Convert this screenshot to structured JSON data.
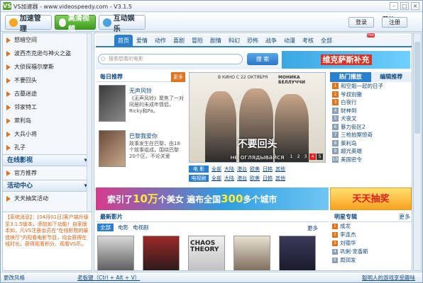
{
  "window": {
    "title": "VS加速器 - www.videospeedy.com - V3.1.5",
    "logo_text": "VS"
  },
  "toolbar": {
    "btn_accelerate": "加速管理",
    "btn_hd": "高清视频",
    "btn_social": "互动娱乐",
    "user": "菜单",
    "login": "登录",
    "register": "注册"
  },
  "sidebar": {
    "items": [
      "怒暗空间",
      "波西杰克逊与神火之盗",
      "大侦探福尔摩斯",
      "不要回头",
      "古墓迷途",
      "邻家特工",
      "萊利岛",
      "大兵小将",
      "孔子"
    ],
    "section_online": "在线影视",
    "online_items": [
      "官方推荐"
    ],
    "section_activity": "活动中心",
    "activity_items": [
      "天天抽奖活动"
    ],
    "system_msg": "【系统消息】：[04月01日]客户端升级至3.1.5版本，添加如下功能！自家版本如，凡VS注册会员在\"在线影院的最佳映厅\"内观看电影节目，均会获得在线时长，获得观看积分、观看VS币。"
  },
  "categories": [
    "首页",
    "爱情",
    "动作",
    "喜剧",
    "冒险",
    "剧情",
    "科幻",
    "恐怖",
    "战争",
    "动漫",
    "考核",
    "全部"
  ],
  "hot_badge": "Hot",
  "search": {
    "placeholder": "搜索想看的电影",
    "button": "搜 索"
  },
  "banner_top": {
    "text": "维克萨斯补充"
  },
  "daily": {
    "title": "每日推荐",
    "more": "更多",
    "cards": [
      {
        "title": "无声风铃",
        "desc": "《无声风铃》聚焦了一对同居的未成年情侣，Ricky和Pa。"
      },
      {
        "title": "巴黎我爱你",
        "desc": "故事发生在巴黎，由18个故事组成，围绕巴黎20个区，不论关爱"
      }
    ]
  },
  "slideshow": {
    "top_left": "В КИНО С 22 ОКТЯБРЯ",
    "top_right": "МОНИКА БЕЛЛУЧЧИ",
    "caption_cn": "不要回头",
    "caption_ru": "не оглядывайся",
    "pages": [
      "1",
      "2",
      "3",
      "4",
      "5"
    ],
    "active_page": "4"
  },
  "cat_rows": [
    {
      "label": "电 影",
      "links": [
        "全部",
        "大陆",
        "港台",
        "欧美",
        "日韩",
        "其他"
      ]
    },
    {
      "label": "电视剧",
      "links": [
        "全部",
        "大陆",
        "港台",
        "欧美",
        "日韩",
        "其他"
      ]
    }
  ],
  "hot_list": {
    "tabs": [
      "热门播放",
      "编辑推荐"
    ],
    "items": [
      "和空姐一起的日子",
      "爷叔别撒",
      "白夜行",
      "财神到",
      "犬夜叉",
      "暴力街区2",
      "三枪拍案惊奇",
      "萊利岛",
      "超光英雄",
      "美国密令"
    ]
  },
  "banner_mid": {
    "text_a": "索引了",
    "num1": "10万",
    "text_b": "个美女",
    "text_c": "遍布全国",
    "num2": "300",
    "text_d": "多个城市"
  },
  "banner_lottery": "天天抽奖",
  "latest": {
    "title": "最新影片",
    "tabs": [
      "全部",
      "电影",
      "电视剧"
    ],
    "more": "更多",
    "posters": [
      {
        "label": ""
      },
      {
        "label": ""
      },
      {
        "label": "CHAOS THEORY"
      },
      {
        "label": ""
      },
      {
        "label": ""
      }
    ]
  },
  "stars": {
    "title": "明星专辑",
    "more": "更多",
    "items": [
      "成龙",
      "李连杰",
      "刘德华",
      "巩俐·宠香斯",
      "周润发"
    ]
  },
  "status": {
    "left": "更改风格",
    "shortcut": "老板键（Ctrl + Alt + V）",
    "right": "聪明人的游戏享受趣味"
  },
  "colors": {
    "accent": "#2a7fd0",
    "green": "#3e9c1d",
    "orange": "#e0731c"
  }
}
